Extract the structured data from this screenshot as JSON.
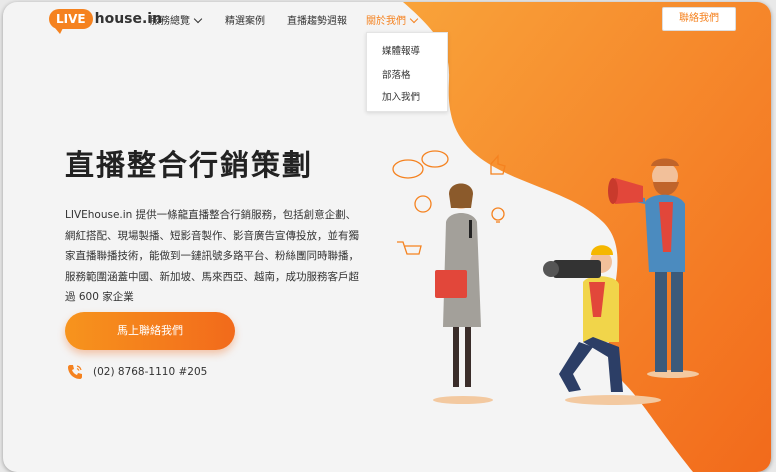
{
  "brand": {
    "logo_bubble": "LIVE",
    "logo_rest": "house.in",
    "accent": "#f5821f"
  },
  "nav": {
    "services": "服務總覽",
    "cases": "精選案例",
    "weekly": "直播趨勢週報",
    "about": "關於我們",
    "contact": "聯絡我們"
  },
  "about_menu": {
    "items": [
      "媒體報導",
      "部落格",
      "加入我們"
    ]
  },
  "hero": {
    "title": "直播整合行銷策劃",
    "description": "LIVEhouse.in 提供一條龍直播整合行銷服務，包括創意企劃、網紅搭配、現場製播、短影音製作、影音廣告宣傳投放，並有獨家直播聯播技術，能做到一鏈訊號多路平台、粉絲團同時聯播，服務範圍涵蓋中國、新加坡、馬來西亞、越南，成功服務客戶超過 600 家企業",
    "cta": "馬上聯絡我們",
    "phone": "(02) 8768-1110 #205"
  },
  "icons": {
    "logo": "speech-bubble-logo",
    "phone": "phone-icon",
    "chevron": "chevron-down-icon"
  }
}
